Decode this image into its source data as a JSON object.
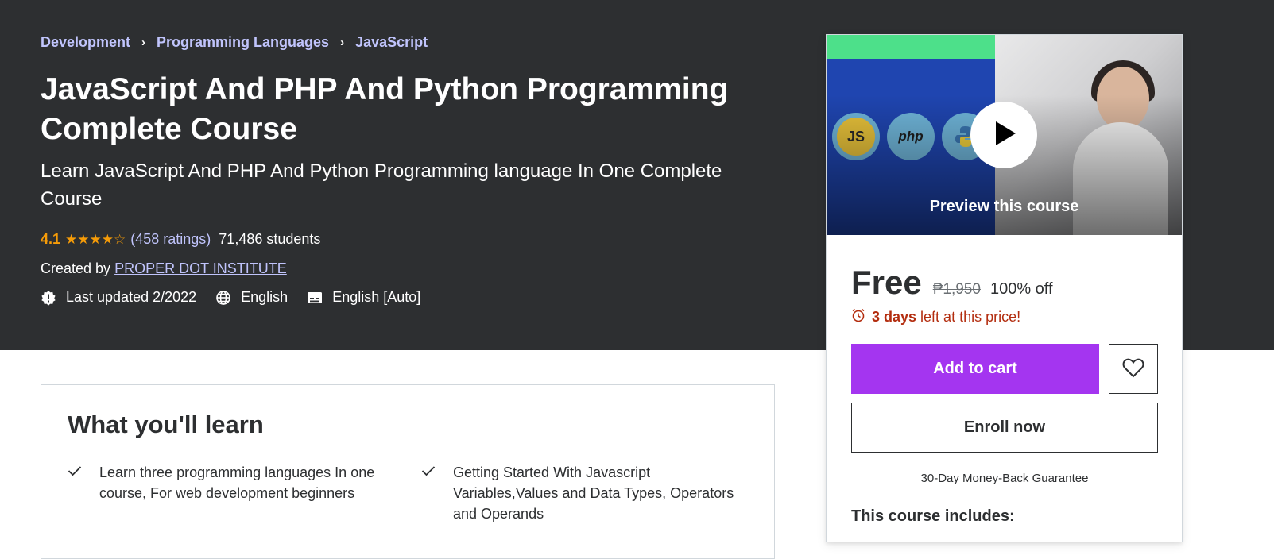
{
  "breadcrumb": {
    "items": [
      "Development",
      "Programming Languages",
      "JavaScript"
    ],
    "separator": "›"
  },
  "course": {
    "title": "JavaScript And PHP And Python Programming Complete Course",
    "subtitle": "Learn JavaScript And PHP And Python Programming language In One Complete Course",
    "rating": "4.1",
    "stars": "★★★★☆",
    "ratings_count": "(458 ratings)",
    "students": "71,486 students",
    "created_by_label": "Created by",
    "instructor": "PROPER DOT INSTITUTE",
    "last_updated": "Last updated 2/2022",
    "language": "English",
    "captions": "English [Auto]"
  },
  "sidebar": {
    "preview_label": "Preview this course",
    "preview_icons": [
      "JS",
      "php"
    ],
    "price": "Free",
    "original_price": "₱1,950",
    "discount": "100% off",
    "timer_bold": "3 days",
    "timer_rest": "left at this price!",
    "add_to_cart": "Add to cart",
    "enroll_now": "Enroll now",
    "guarantee": "30-Day Money-Back Guarantee",
    "includes_title": "This course includes:"
  },
  "learn": {
    "title": "What you'll learn",
    "items": [
      "Learn three programming languages In one course, For web development beginners",
      "Getting Started With Javascript Variables,Values and Data Types, Operators and Operands"
    ]
  },
  "colors": {
    "hero_bg": "#2d2f31",
    "link": "#c0c4fc",
    "star": "#f69c08",
    "accent_purple": "#a435f0",
    "timer_red": "#b32d0f"
  }
}
